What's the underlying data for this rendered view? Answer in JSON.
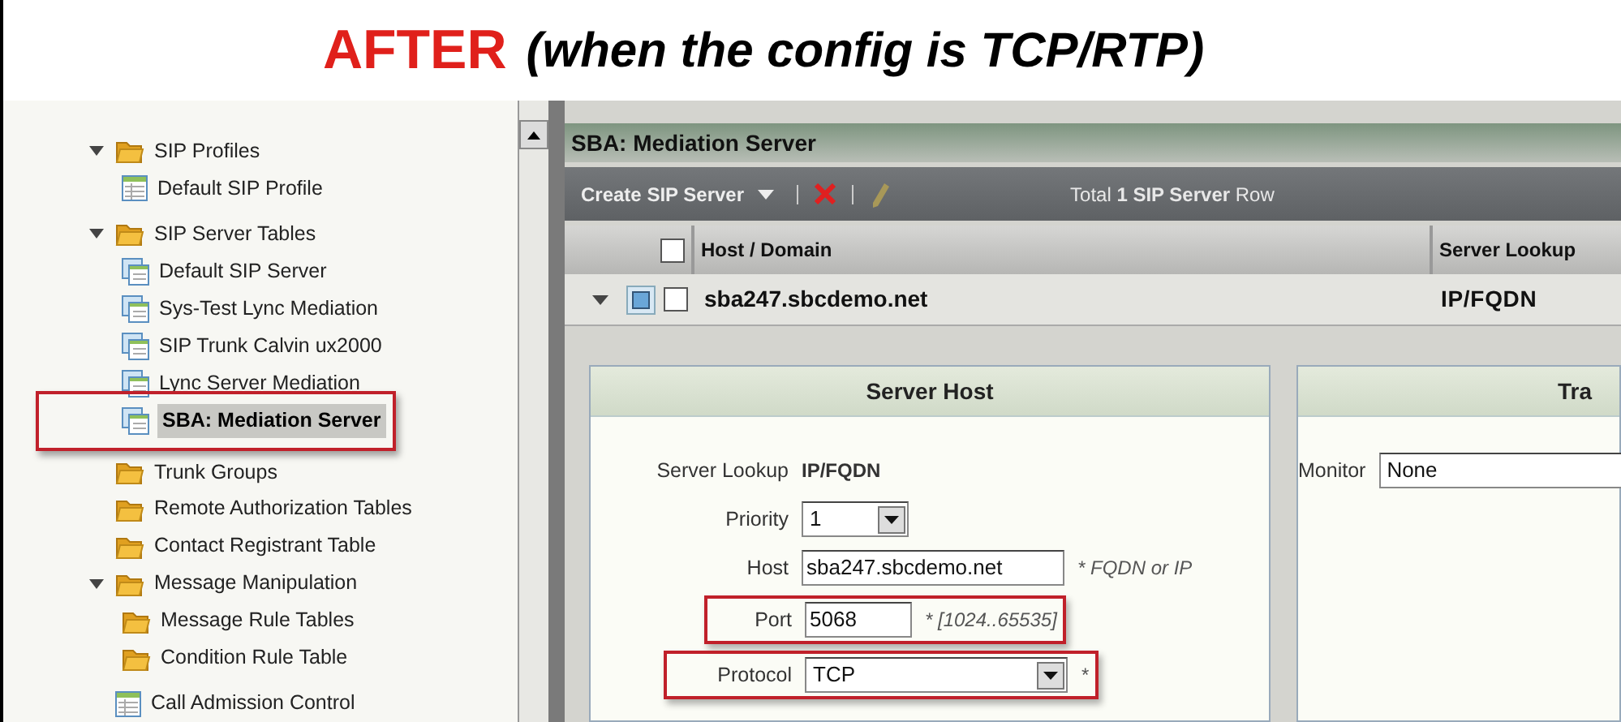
{
  "banner": {
    "heading": "AFTER",
    "subtitle": "(when the config is TCP/RTP)"
  },
  "tree": [
    {
      "label": "SIP Profiles",
      "kind": "folder",
      "expanded": true,
      "selected": false,
      "children": [
        {
          "label": "Default SIP Profile",
          "kind": "table",
          "selected": false
        }
      ]
    },
    {
      "label": "SIP Server Tables",
      "kind": "folder",
      "expanded": true,
      "selected": false,
      "children": [
        {
          "label": "Default SIP Server",
          "kind": "server",
          "selected": false
        },
        {
          "label": "Sys-Test Lync Mediation",
          "kind": "server",
          "selected": false
        },
        {
          "label": "SIP Trunk Calvin ux2000",
          "kind": "server",
          "selected": false
        },
        {
          "label": "Lync Server Mediation",
          "kind": "server",
          "selected": false
        },
        {
          "label": "SBA: Mediation Server",
          "kind": "server",
          "selected": true
        }
      ]
    },
    {
      "label": "Trunk Groups",
      "kind": "folder",
      "expanded": false,
      "selected": false
    },
    {
      "label": "Remote Authorization Tables",
      "kind": "folder",
      "expanded": false,
      "selected": false
    },
    {
      "label": "Contact Registrant Table",
      "kind": "folder",
      "expanded": false,
      "selected": false
    },
    {
      "label": "Message Manipulation",
      "kind": "folder",
      "expanded": true,
      "selected": false,
      "children": [
        {
          "label": "Message Rule Tables",
          "kind": "folder",
          "expanded": false,
          "selected": false
        },
        {
          "label": "Condition Rule Table",
          "kind": "folder",
          "expanded": false,
          "selected": false
        }
      ]
    },
    {
      "label": "Call Admission Control",
      "kind": "table",
      "selected": false
    }
  ],
  "main": {
    "title": "SBA: Mediation Server",
    "toolbar": {
      "create": "Create SIP Server",
      "total": "Total **1 SIP Server** Row"
    },
    "table": {
      "columns": [
        "Host / Domain",
        "Server Lookup"
      ],
      "header_checked": false,
      "rows": [
        {
          "expanded": true,
          "checked": false,
          "cells": [
            "sba247.sbcdemo.net",
            "IP/FQDN"
          ]
        }
      ]
    },
    "panels": [
      {
        "title": "Server Host",
        "fields": [
          {
            "kind": "static",
            "label": "Server Lookup",
            "value": "IP/FQDN",
            "highlighted": false
          },
          {
            "kind": "select",
            "label": "Priority",
            "value": "1",
            "highlighted": false
          },
          {
            "kind": "input",
            "label": "Host",
            "value": "sba247.sbcdemo.net",
            "hint": "* FQDN or IP",
            "highlighted": false
          },
          {
            "kind": "input",
            "label": "Port",
            "value": "5068",
            "hint": "* [1024..65535]",
            "highlighted": true
          },
          {
            "kind": "select",
            "label": "Protocol",
            "value": "TCP",
            "hint": "*",
            "highlighted": true
          }
        ]
      },
      {
        "title": "Tra",
        "fields": [
          {
            "kind": "select",
            "label": "Monitor",
            "value": "None",
            "highlighted": false
          }
        ]
      }
    ]
  }
}
